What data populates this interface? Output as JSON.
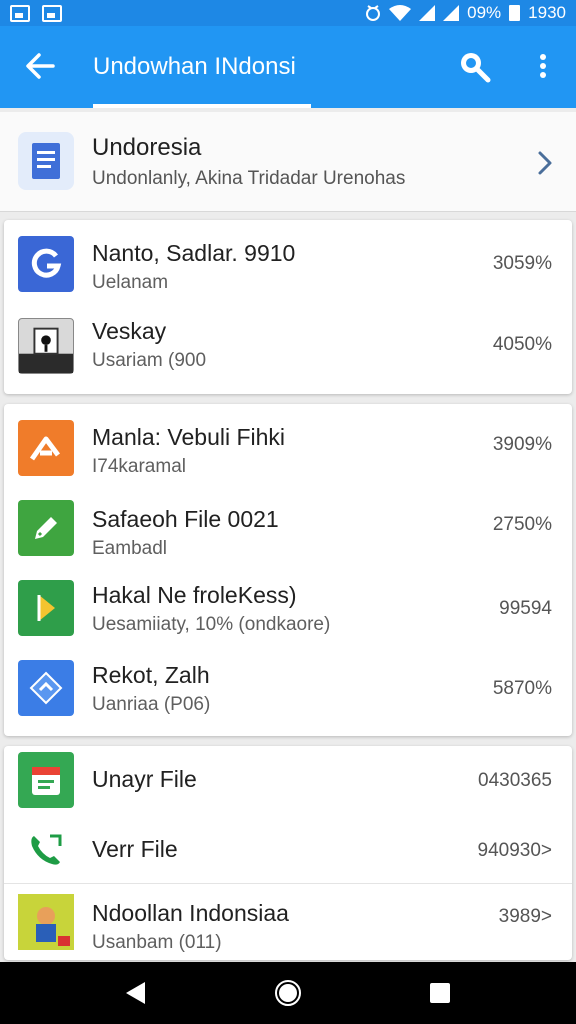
{
  "status_bar": {
    "battery_text": "09%",
    "time": "1930"
  },
  "app_bar": {
    "title": "Undowhan INdonsi"
  },
  "header": {
    "title": "Undoresia",
    "subtitle": "Undonlanly, Akina Tridadar Urenohas"
  },
  "card1": [
    {
      "name": "Nanto, Sadlar. 9910",
      "sub": "Uelanam",
      "value": "3059%",
      "icon": "g-letter-icon",
      "color": "#3a67d6"
    },
    {
      "name": "Veskay",
      "sub": "Usariam (900",
      "value": "4050%",
      "icon": "map-pin-icon",
      "color": "#2b2b2b"
    }
  ],
  "card2": [
    {
      "name": "Manla: Vebuli Fihki",
      "sub": "I74karamal",
      "value": "3909%",
      "icon": "arrow-icon",
      "color": "#f07c2a"
    },
    {
      "name": "Safaeoh File 0021",
      "sub": "Eambadl",
      "value": "2750%",
      "icon": "edit-icon",
      "color": "#3fa540"
    },
    {
      "name": "Hakal Ne froleKess)",
      "sub": "Uesamiiaty, 10% (ondkaore)",
      "value": "99594",
      "icon": "play-icon",
      "color": "#2f9e4a"
    },
    {
      "name": "Rekot, Zalh",
      "sub": "Uanriaa (P06)",
      "value": "5870%",
      "icon": "diamond-icon",
      "color": "#3b7de6"
    }
  ],
  "card3": [
    {
      "name": "Unayr File",
      "sub": "",
      "value": "0430365",
      "icon": "calendar-icon",
      "color": "#34a853"
    },
    {
      "name": "Verr File",
      "sub": "",
      "value": "940930>",
      "icon": "phone-icon",
      "color": "#ffffff"
    },
    {
      "name": "Ndoollan Indonsiaa",
      "sub": "Usanbam (011)",
      "value": "3989>",
      "icon": "game-icon",
      "color": "#d6c93a"
    }
  ],
  "colors": {
    "accent": "#2196f3",
    "statusbar": "#1e88e5"
  }
}
